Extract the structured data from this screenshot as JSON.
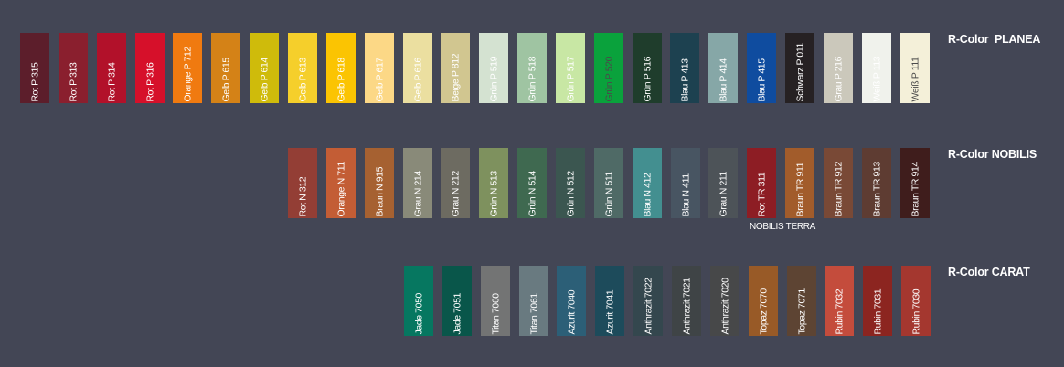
{
  "rows": [
    {
      "title": "R-Color  PLANEA",
      "swatches": [
        {
          "label": "Rot P 315",
          "color": "#5c1e2b",
          "text": "light"
        },
        {
          "label": "Rot P 313",
          "color": "#8a1f2e",
          "text": "light"
        },
        {
          "label": "Rot P 314",
          "color": "#b2112a",
          "text": "light"
        },
        {
          "label": "Rot P 316",
          "color": "#d6102a",
          "text": "light"
        },
        {
          "label": "Orange P 712",
          "color": "#f07a10",
          "text": "light"
        },
        {
          "label": "Gelb P 615",
          "color": "#d48217",
          "text": "light"
        },
        {
          "label": "Gelb P 614",
          "color": "#cfbb0b",
          "text": "light"
        },
        {
          "label": "Gelb P 613",
          "color": "#f5cf2b",
          "text": "light"
        },
        {
          "label": "Gelb P 618",
          "color": "#fbc402",
          "text": "light"
        },
        {
          "label": "Gelb P 617",
          "color": "#fcd886",
          "text": "light"
        },
        {
          "label": "Gelb P 616",
          "color": "#ebdfa0",
          "text": "light"
        },
        {
          "label": "Beige P 812",
          "color": "#d1c690",
          "text": "light"
        },
        {
          "label": "Grün P 519",
          "color": "#d4e2d1",
          "text": "light"
        },
        {
          "label": "Grün P 518",
          "color": "#9fc4a2",
          "text": "light"
        },
        {
          "label": "Grün P 517",
          "color": "#c8e7a4",
          "text": "light"
        },
        {
          "label": "Grün P 520",
          "color": "#0aa23c",
          "text": "dark"
        },
        {
          "label": "Grün P 516",
          "color": "#1f3d2c",
          "text": "light"
        },
        {
          "label": "Blau P 413",
          "color": "#1d4150",
          "text": "light"
        },
        {
          "label": "Blau P 414",
          "color": "#86a7a7",
          "text": "light"
        },
        {
          "label": "Blau P 415",
          "color": "#0f4c9f",
          "text": "light"
        },
        {
          "label": "Schwarz P 011",
          "color": "#262123",
          "text": "light"
        },
        {
          "label": "Grau P 216",
          "color": "#cbc8bb",
          "text": "light"
        },
        {
          "label": "Weiß P 113",
          "color": "#f0f2ec",
          "text": "light"
        },
        {
          "label": "Weiß P 111",
          "color": "#f4f0d9",
          "text": "dark"
        }
      ]
    },
    {
      "title": "R-Color NOBILIS",
      "sub_label": "NOBILIS TERRA",
      "swatches": [
        {
          "label": "Rot N 312",
          "color": "#933e35",
          "text": "light"
        },
        {
          "label": "Orange N 711",
          "color": "#c35d35",
          "text": "light"
        },
        {
          "label": "Braun N 915",
          "color": "#a66131",
          "text": "light"
        },
        {
          "label": "Grau N 214",
          "color": "#898a79",
          "text": "light"
        },
        {
          "label": "Grau N 212",
          "color": "#6d6b61",
          "text": "light"
        },
        {
          "label": "Grün N 513",
          "color": "#7e915e",
          "text": "light"
        },
        {
          "label": "Grün N 514",
          "color": "#3f6950",
          "text": "light"
        },
        {
          "label": "Grün N 512",
          "color": "#3b5650",
          "text": "light"
        },
        {
          "label": "Grün N 511",
          "color": "#4f6a66",
          "text": "light"
        },
        {
          "label": "Blau N 412",
          "color": "#438f90",
          "text": "light"
        },
        {
          "label": "Blau N 411",
          "color": "#485562",
          "text": "light"
        },
        {
          "label": "Grau N 211",
          "color": "#4d5358",
          "text": "light"
        },
        {
          "label": "Rot TR 311",
          "color": "#8d1d24",
          "text": "light"
        },
        {
          "label": "Braun TR 911",
          "color": "#a25c2b",
          "text": "light"
        },
        {
          "label": "Braun TR 912",
          "color": "#794936",
          "text": "light"
        },
        {
          "label": "Braun TR 913",
          "color": "#5e3c32",
          "text": "light"
        },
        {
          "label": "Braun TR 914",
          "color": "#3f1d1c",
          "text": "light"
        }
      ]
    },
    {
      "title": "R-Color CARAT",
      "swatches": [
        {
          "label": "Jade 7050",
          "color": "#067760",
          "text": "light"
        },
        {
          "label": "Jade 7051",
          "color": "#09564a",
          "text": "light"
        },
        {
          "label": "Titan 7060",
          "color": "#737474",
          "text": "light"
        },
        {
          "label": "Titan 7061",
          "color": "#697a80",
          "text": "light"
        },
        {
          "label": "Azurit 7040",
          "color": "#2c5f77",
          "text": "light"
        },
        {
          "label": "Azurit 7041",
          "color": "#1d4b5b",
          "text": "light"
        },
        {
          "label": "Anthrazit 7022",
          "color": "#34474e",
          "text": "light"
        },
        {
          "label": "Anthrazit 7021",
          "color": "#3f4446",
          "text": "light"
        },
        {
          "label": "Anthrazit 7020",
          "color": "#474849",
          "text": "light"
        },
        {
          "label": "Topaz 7070",
          "color": "#985a27",
          "text": "light"
        },
        {
          "label": "Topaz 7071",
          "color": "#5d4433",
          "text": "light"
        },
        {
          "label": "Rubin 7032",
          "color": "#c44c3c",
          "text": "light"
        },
        {
          "label": "Rubin 7031",
          "color": "#8c2520",
          "text": "light"
        },
        {
          "label": "Rubin 7030",
          "color": "#a4372f",
          "text": "light"
        }
      ]
    }
  ]
}
